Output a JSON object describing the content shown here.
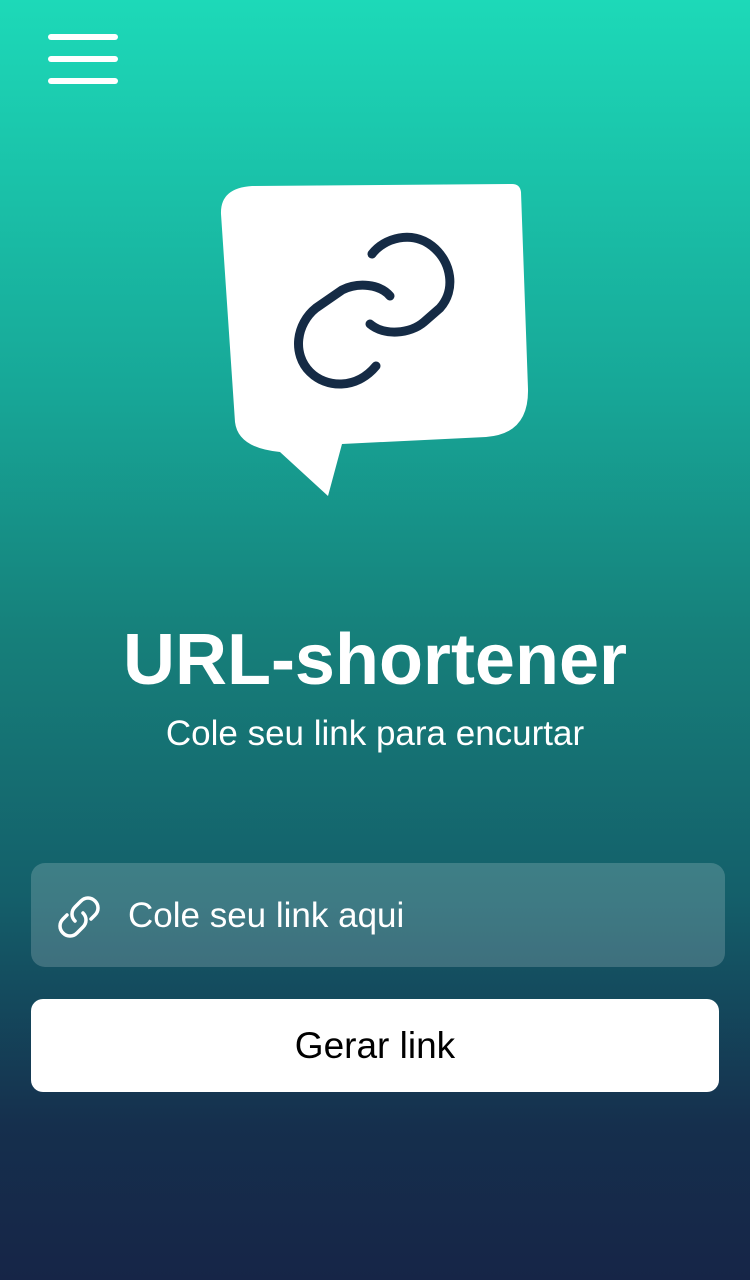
{
  "header": {
    "menu_icon": "menu-icon"
  },
  "logo": {
    "icon": "link-chat-bubble-icon",
    "bubble_color": "#ffffff",
    "link_color": "#152b45"
  },
  "main": {
    "title": "URL-shortener",
    "subtitle": "Cole seu link para encurtar"
  },
  "form": {
    "input_icon": "link-icon",
    "input_placeholder": "Cole seu link aqui",
    "input_value": "",
    "button_label": "Gerar link"
  },
  "colors": {
    "gradient_top": "#1dd9b8",
    "gradient_bottom": "#162547",
    "button_background": "#ffffff",
    "text": "#ffffff"
  }
}
